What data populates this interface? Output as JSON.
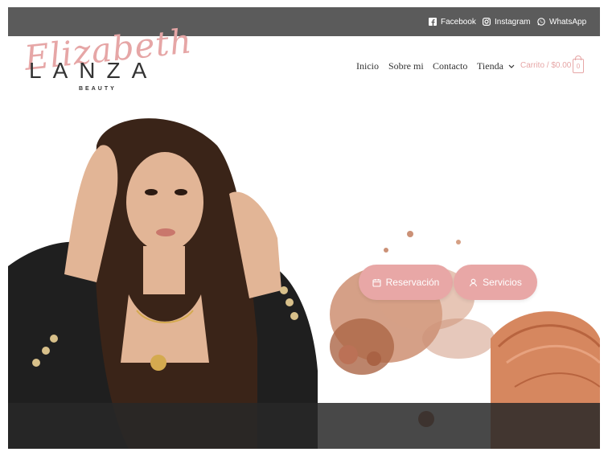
{
  "topbar": {
    "links": [
      {
        "label": "Facebook",
        "icon": "facebook-icon"
      },
      {
        "label": "Instagram",
        "icon": "instagram-icon"
      },
      {
        "label": "WhatsApp",
        "icon": "whatsapp-icon"
      }
    ]
  },
  "logo": {
    "script": "Elizabeth",
    "main": "LANZA",
    "sub": "BEAUTY"
  },
  "nav": {
    "items": [
      {
        "label": "Inicio"
      },
      {
        "label": "Sobre mi"
      },
      {
        "label": "Contacto"
      },
      {
        "label": "Tienda"
      }
    ],
    "cart_label": "Carrito / $0.00",
    "cart_count": "0"
  },
  "hero": {
    "buttons": [
      {
        "label": "Reservación",
        "icon": "calendar-icon"
      },
      {
        "label": "Servicios",
        "icon": "user-icon"
      }
    ]
  },
  "colors": {
    "topbar": "#5b5b5b",
    "accent": "#e8a7a6",
    "text": "#333333"
  }
}
